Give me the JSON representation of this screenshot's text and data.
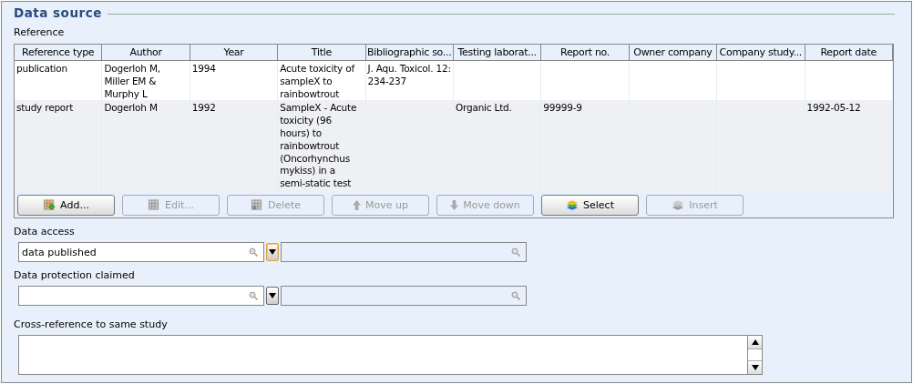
{
  "section": {
    "title": "Data source"
  },
  "reference": {
    "label": "Reference",
    "columns": [
      "Reference type",
      "Author",
      "Year",
      "Title",
      "Bibliographic so...",
      "Testing laborat...",
      "Report no.",
      "Owner company",
      "Company study...",
      "Report date"
    ],
    "rows": [
      {
        "selected": false,
        "cells": [
          "publication",
          "Dogerloh M, Miller EM & Murphy L",
          "1994",
          "Acute toxicity of sampleX to rainbowtrout",
          "J. Aqu. Toxicol. 12: 234-237",
          "",
          "",
          "",
          "",
          ""
        ]
      },
      {
        "selected": true,
        "cells": [
          "study report",
          "Dogerloh M",
          "1992",
          "SampleX - Acute toxicity (96 hours) to rainbowtrout (Oncorhynchus mykiss) in a semi-static test",
          "",
          "Organic Ltd.",
          "99999-9",
          "",
          "",
          "1992-05-12"
        ]
      }
    ],
    "buttons": [
      {
        "kind": "add",
        "label": "Add...",
        "disabled": false
      },
      {
        "kind": "edit",
        "label": "Edit...",
        "disabled": true
      },
      {
        "kind": "delete",
        "label": "Delete",
        "disabled": true
      },
      {
        "kind": "up",
        "label": "Move up",
        "disabled": true
      },
      {
        "kind": "down",
        "label": "Move down",
        "disabled": true
      },
      {
        "kind": "select",
        "label": "Select",
        "disabled": false
      },
      {
        "kind": "insert",
        "label": "Insert",
        "disabled": true
      }
    ]
  },
  "pickers": [
    {
      "label": "Data access",
      "value": "data published",
      "highlighted": true
    },
    {
      "label": "Data protection claimed",
      "highlighted": false
    }
  ],
  "cross_reference": {
    "label": "Cross-reference to same study"
  }
}
